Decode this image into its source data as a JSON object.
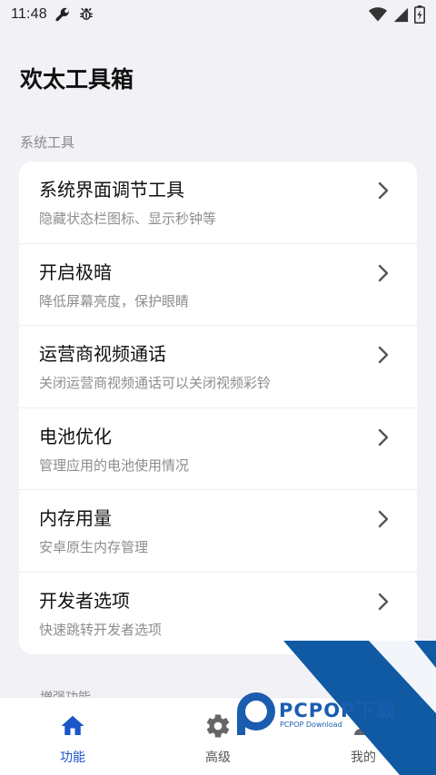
{
  "status_bar": {
    "time": "11:48",
    "left_icons": [
      "wrench-icon",
      "bug-icon"
    ],
    "right_icons": [
      "wifi-icon",
      "cellular-signal-icon",
      "battery-icon"
    ]
  },
  "app": {
    "title": "欢太工具箱"
  },
  "section": {
    "label": "系统工具",
    "next_label": "増强功能"
  },
  "items": [
    {
      "title": "系统界面调节工具",
      "subtitle": "隐藏状态栏图标、显示秒钟等"
    },
    {
      "title": "开启极暗",
      "subtitle": "降低屏幕亮度，保护眼睛"
    },
    {
      "title": "运营商视频通话",
      "subtitle": "关闭运营商视频通话可以关闭视频彩铃"
    },
    {
      "title": "电池优化",
      "subtitle": "管理应用的电池使用情况"
    },
    {
      "title": "内存用量",
      "subtitle": "安卓原生内存管理"
    },
    {
      "title": "开发者选项",
      "subtitle": "快速跳转开发者选项"
    }
  ],
  "bottom_nav": {
    "tabs": [
      {
        "label": "功能",
        "icon": "home-icon",
        "active": true
      },
      {
        "label": "高级",
        "icon": "gear-icon",
        "active": false
      },
      {
        "label": "我的",
        "icon": "person-icon",
        "active": false
      }
    ]
  },
  "watermark": {
    "text": "PCPOP下载",
    "subtext": "PCPOP Download"
  },
  "colors": {
    "accent": "#1a56c8",
    "background": "#f2f1f6",
    "card": "#ffffff",
    "secondary_text": "#8d8d92"
  }
}
